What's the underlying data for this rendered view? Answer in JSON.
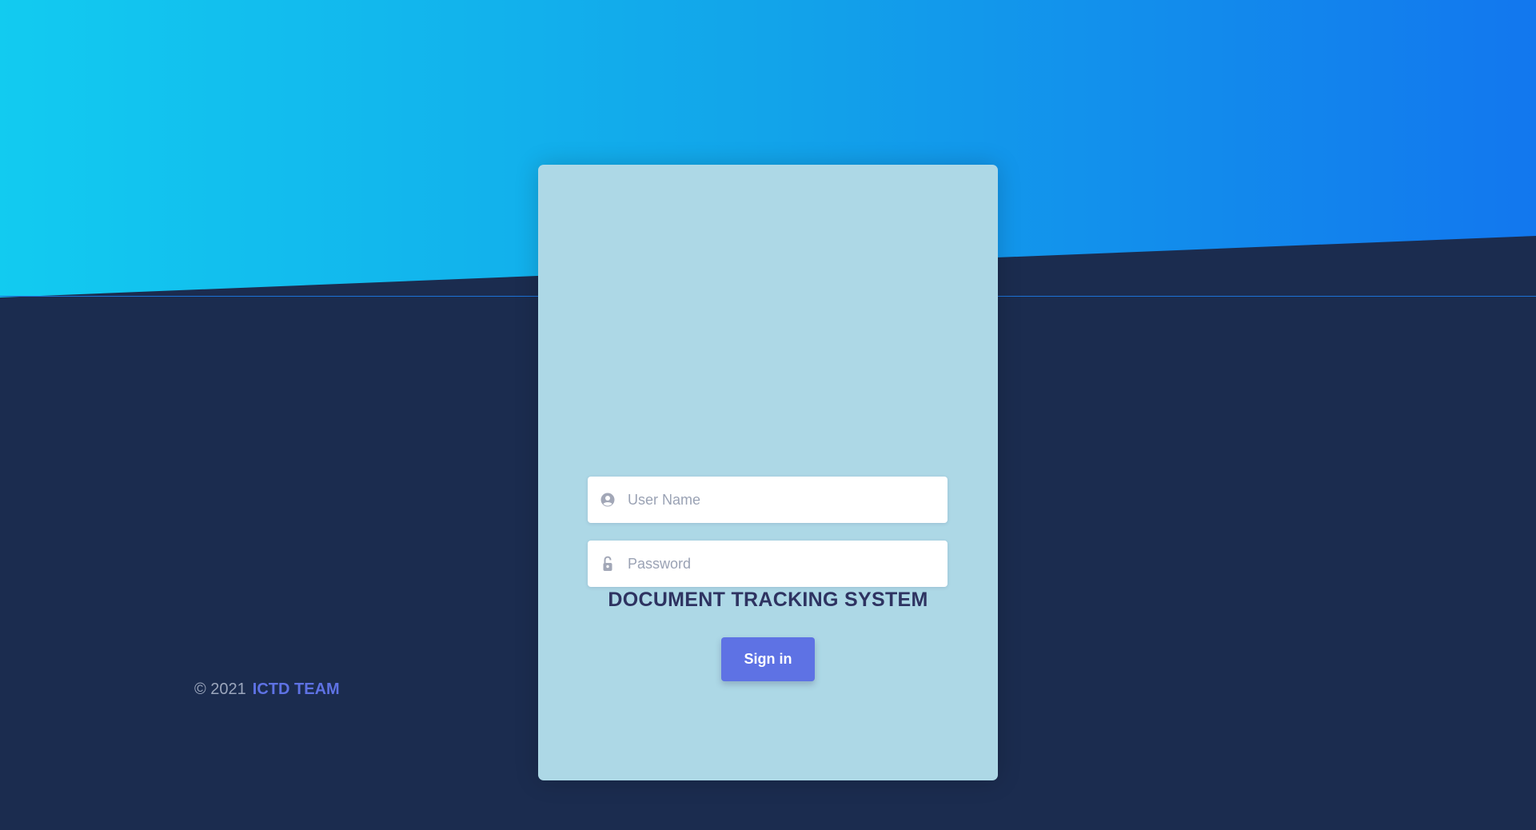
{
  "login": {
    "title": "DOCUMENT TRACKING SYSTEM",
    "username_placeholder": "User Name",
    "username_value": "",
    "password_placeholder": "Password",
    "password_value": "",
    "signin_label": "Sign in",
    "username_icon": "user-circle-icon",
    "password_icon": "lock-icon"
  },
  "footer": {
    "copyright": "© 2021",
    "team": "ICTD TEAM"
  },
  "colors": {
    "accent": "#5e72e4",
    "background": "#1b2c4f",
    "card": "#add8e6",
    "hero_start": "#12cbf0",
    "hero_end": "#1277ee",
    "title": "#2e3361"
  }
}
